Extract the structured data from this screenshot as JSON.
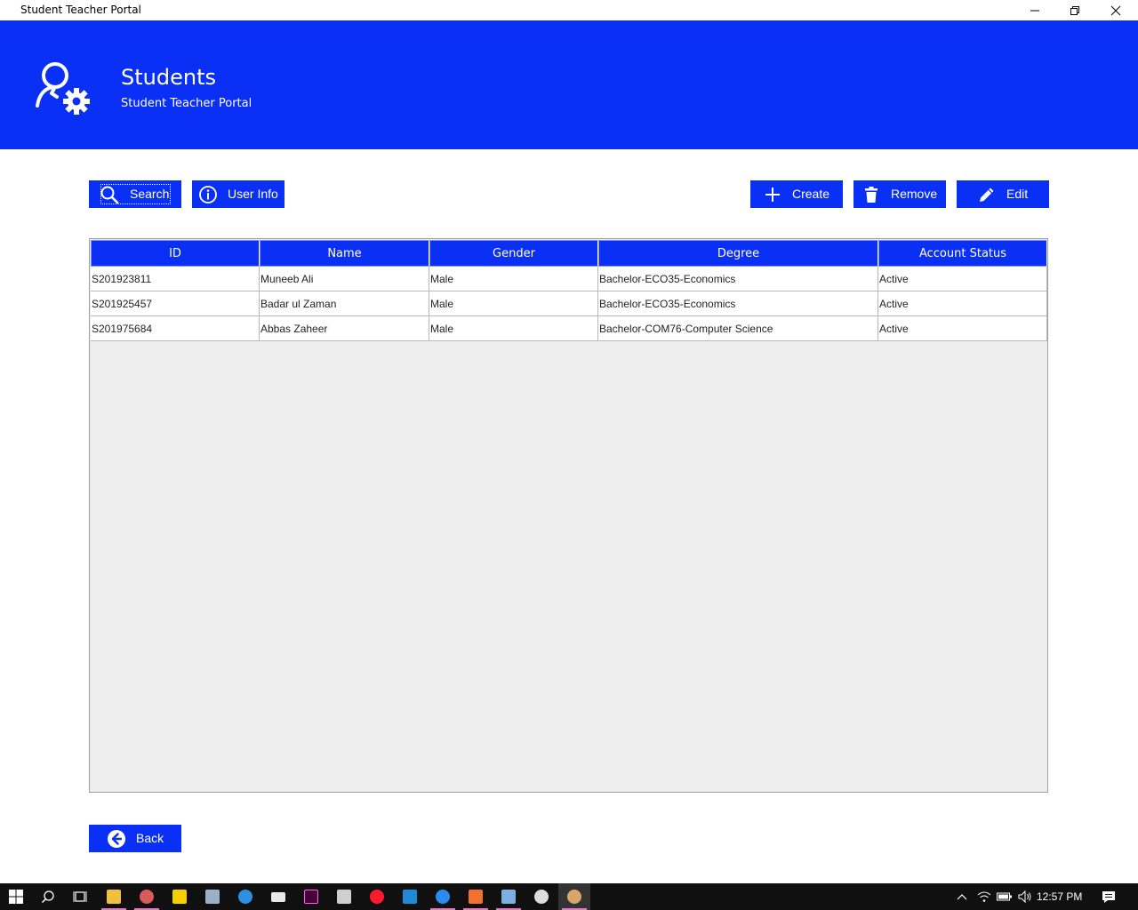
{
  "window": {
    "title": "Student Teacher Portal"
  },
  "header": {
    "title": "Students",
    "subtitle": "Student Teacher Portal"
  },
  "toolbar": {
    "search_label": "Search",
    "user_info_label": "User Info",
    "create_label": "Create",
    "remove_label": "Remove",
    "edit_label": "Edit"
  },
  "table": {
    "columns": [
      "ID",
      "Name",
      "Gender",
      "Degree",
      "Account Status"
    ],
    "rows": [
      [
        "S201923811",
        "Muneeb Ali",
        "Male",
        "Bachelor-ECO35-Economics",
        "Active"
      ],
      [
        "S201925457",
        "Badar ul Zaman",
        "Male",
        "Bachelor-ECO35-Economics",
        "Active"
      ],
      [
        "S201975684",
        "Abbas Zaheer",
        "Male",
        "Bachelor-COM76-Computer Science",
        "Active"
      ]
    ]
  },
  "footer": {
    "back_label": "Back"
  },
  "taskbar": {
    "clock": "12:57 PM",
    "apps": [
      "windows-start-icon",
      "search-icon",
      "task-view-icon",
      "file-explorer-icon",
      "paint-icon",
      "sticky-notes-icon",
      "photos-icon",
      "edge-icon",
      "mail-icon",
      "adobe-xd-icon",
      "store-icon",
      "opera-icon",
      "vscode-icon",
      "firefox-icon",
      "xampp-icon",
      "virtualbox-icon",
      "app-icon",
      "java-app-icon"
    ]
  },
  "colors": {
    "accent": "#0a2ff5",
    "table_bg": "#ededed",
    "taskbar": "#101010"
  }
}
